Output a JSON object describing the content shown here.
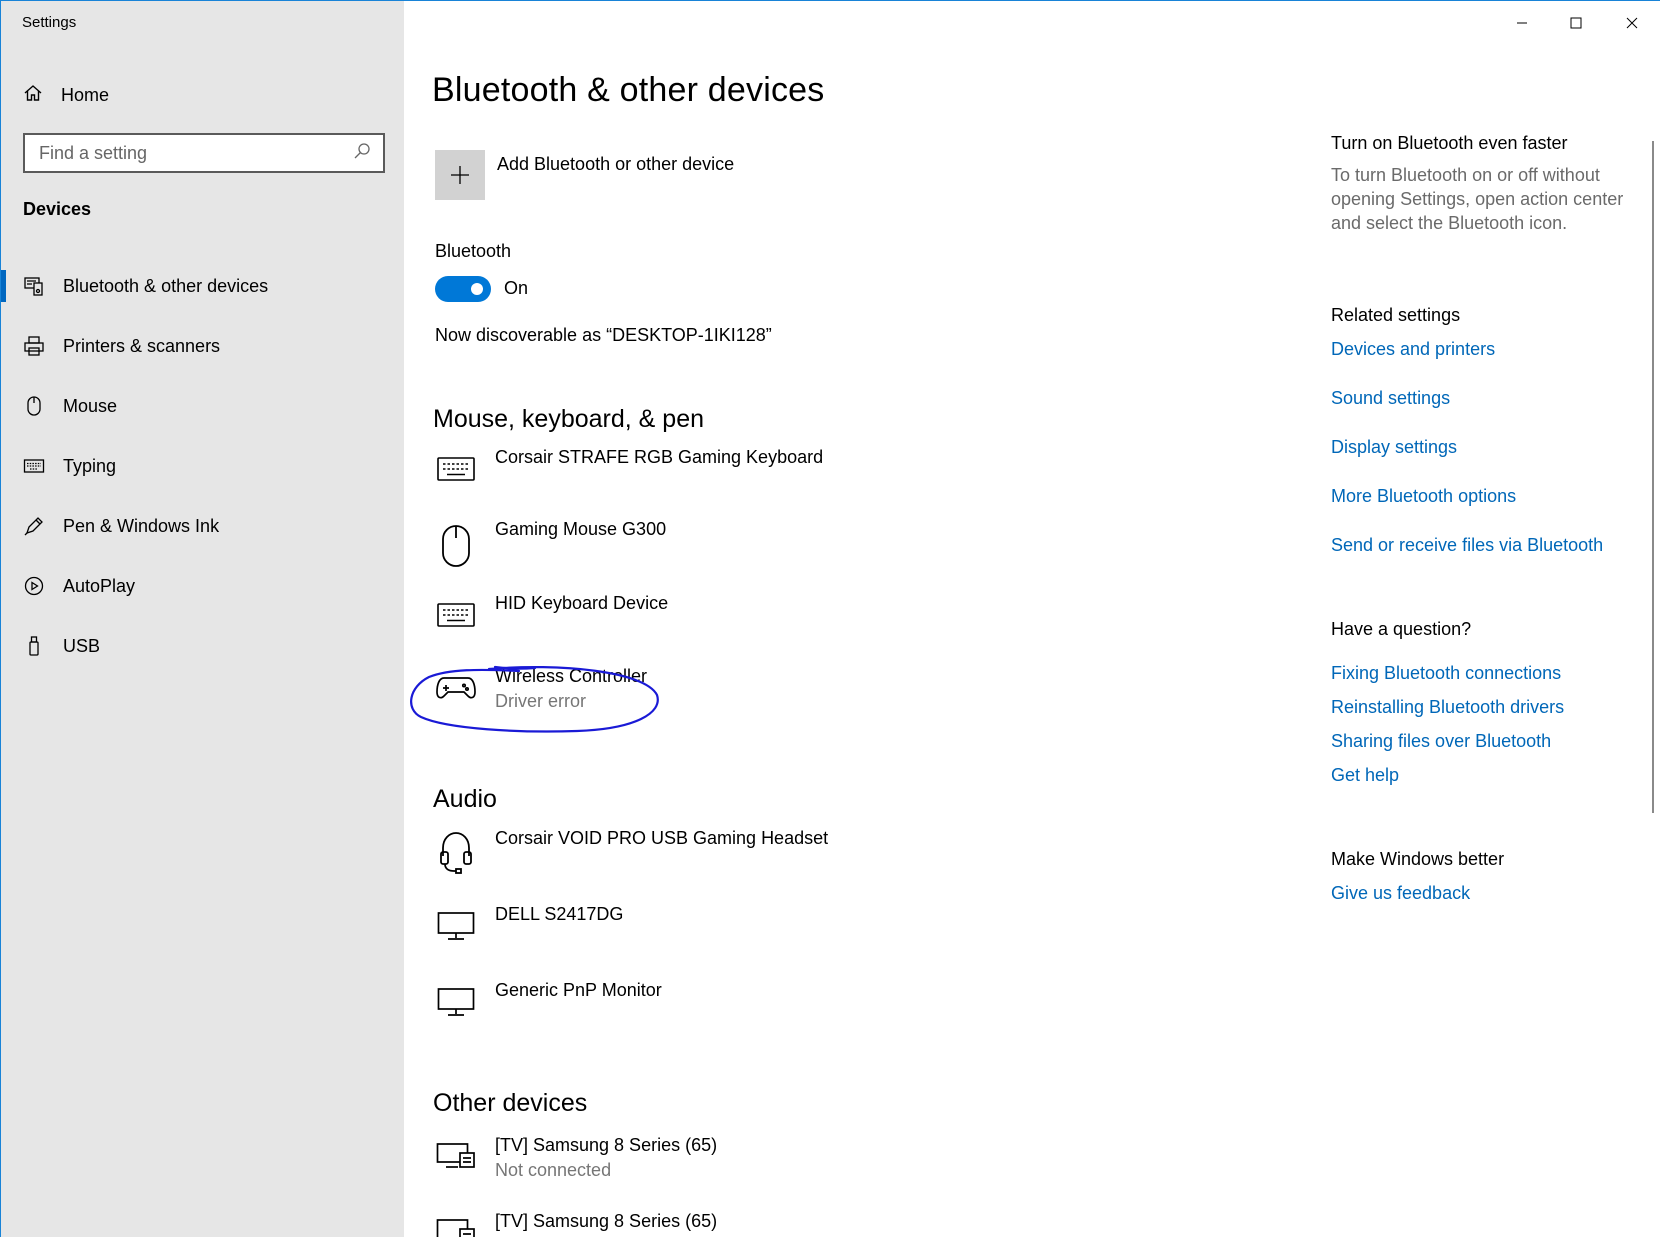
{
  "window": {
    "title": "Settings"
  },
  "sidebar": {
    "home_label": "Home",
    "search_placeholder": "Find a setting",
    "section_title": "Devices",
    "items": [
      {
        "label": "Bluetooth & other devices",
        "icon": "bluetooth-devices-icon",
        "active": true
      },
      {
        "label": "Printers & scanners",
        "icon": "printer-icon"
      },
      {
        "label": "Mouse",
        "icon": "mouse-icon"
      },
      {
        "label": "Typing",
        "icon": "keyboard-icon"
      },
      {
        "label": "Pen & Windows Ink",
        "icon": "pen-icon"
      },
      {
        "label": "AutoPlay",
        "icon": "autoplay-icon"
      },
      {
        "label": "USB",
        "icon": "usb-icon"
      }
    ]
  },
  "main": {
    "title": "Bluetooth & other devices",
    "add_device_label": "Add Bluetooth or other device",
    "bluetooth_label": "Bluetooth",
    "bluetooth_state": "On",
    "discoverable_text": "Now discoverable as “DESKTOP-1IKI128”",
    "groups": [
      {
        "title": "Mouse, keyboard, & pen",
        "devices": [
          {
            "name": "Corsair STRAFE RGB Gaming Keyboard",
            "icon": "keyboard-icon"
          },
          {
            "name": "Gaming Mouse G300",
            "icon": "mouse-icon"
          },
          {
            "name": "HID Keyboard Device",
            "icon": "keyboard-icon"
          },
          {
            "name": "Wireless Controller",
            "status": "Driver error",
            "icon": "gamepad-icon"
          }
        ]
      },
      {
        "title": "Audio",
        "devices": [
          {
            "name": "Corsair VOID PRO USB Gaming Headset",
            "icon": "headset-icon"
          },
          {
            "name": "DELL S2417DG",
            "icon": "monitor-icon"
          },
          {
            "name": "Generic PnP Monitor",
            "icon": "monitor-icon"
          }
        ]
      },
      {
        "title": "Other devices",
        "devices": [
          {
            "name": "[TV] Samsung 8 Series (65)",
            "status": "Not connected",
            "icon": "tv-icon"
          },
          {
            "name": "[TV] Samsung 8 Series (65)",
            "icon": "tv-icon"
          }
        ]
      }
    ]
  },
  "right": {
    "faster_title": "Turn on Bluetooth even faster",
    "faster_text": "To turn Bluetooth on or off without opening Settings, open action center and select the Bluetooth icon.",
    "related_title": "Related settings",
    "related_links": [
      "Devices and printers",
      "Sound settings",
      "Display settings",
      "More Bluetooth options",
      "Send or receive files via Bluetooth"
    ],
    "question_title": "Have a question?",
    "question_links": [
      "Fixing Bluetooth connections",
      "Reinstalling Bluetooth drivers",
      "Sharing files over Bluetooth",
      "Get help"
    ],
    "better_title": "Make Windows better",
    "feedback_link": "Give us feedback"
  },
  "colors": {
    "accent": "#0078d7",
    "link": "#0067b8",
    "sidebar_bg": "#e6e6e6",
    "annotation": "#1a1ad6"
  }
}
